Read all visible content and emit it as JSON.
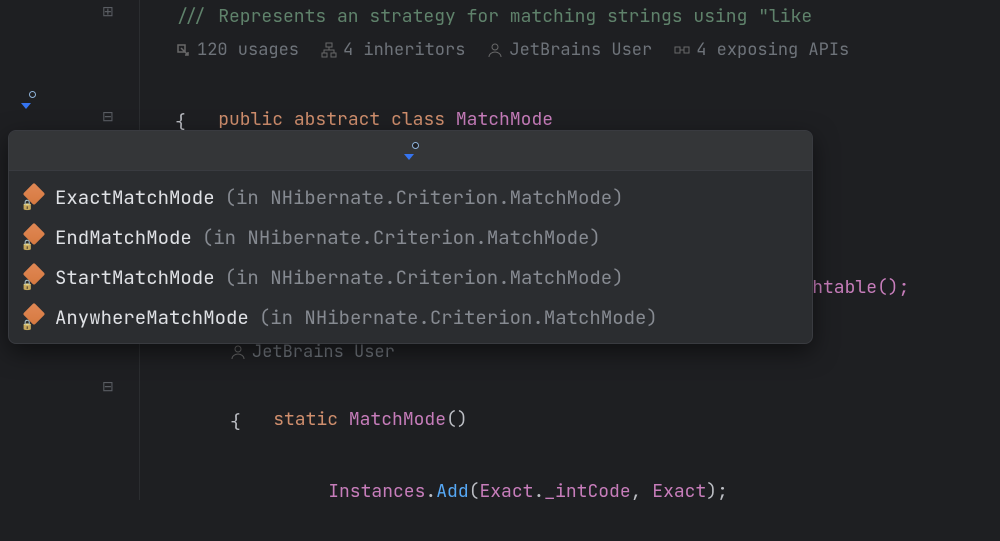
{
  "code": {
    "doc_line": "/// Represents an strategy for matching strings using \"like",
    "decl_tokens": {
      "public": "public",
      "abstract": "abstract",
      "class": "class",
      "name": "MatchMode"
    },
    "open_brace": "{",
    "hashtable_tail": "Hashtable();",
    "static_ctor": {
      "static": "static",
      "name": "MatchMode",
      "parens": "()"
    },
    "ctor_open_brace": "{",
    "instances_line": {
      "obj": "Instances",
      "dot1": ".",
      "method": "Add",
      "open": "(",
      "arg1a": "Exact",
      "dot2": ".",
      "arg1b": "_intCode",
      "comma": ", ",
      "arg2": "Exact",
      "close": ");"
    }
  },
  "hints": {
    "usages": "120 usages",
    "inheritors": "4 inheritors",
    "author": "JetBrains User",
    "exposing": "4 exposing APIs",
    "author2": "JetBrains User"
  },
  "popup": {
    "items": [
      {
        "name": "ExactMatchMode",
        "loc": "(in NHibernate.Criterion.MatchMode)"
      },
      {
        "name": "EndMatchMode",
        "loc": "(in NHibernate.Criterion.MatchMode)"
      },
      {
        "name": "StartMatchMode",
        "loc": "(in NHibernate.Criterion.MatchMode)"
      },
      {
        "name": "AnywhereMatchMode",
        "loc": "(in NHibernate.Criterion.MatchMode)"
      }
    ]
  }
}
